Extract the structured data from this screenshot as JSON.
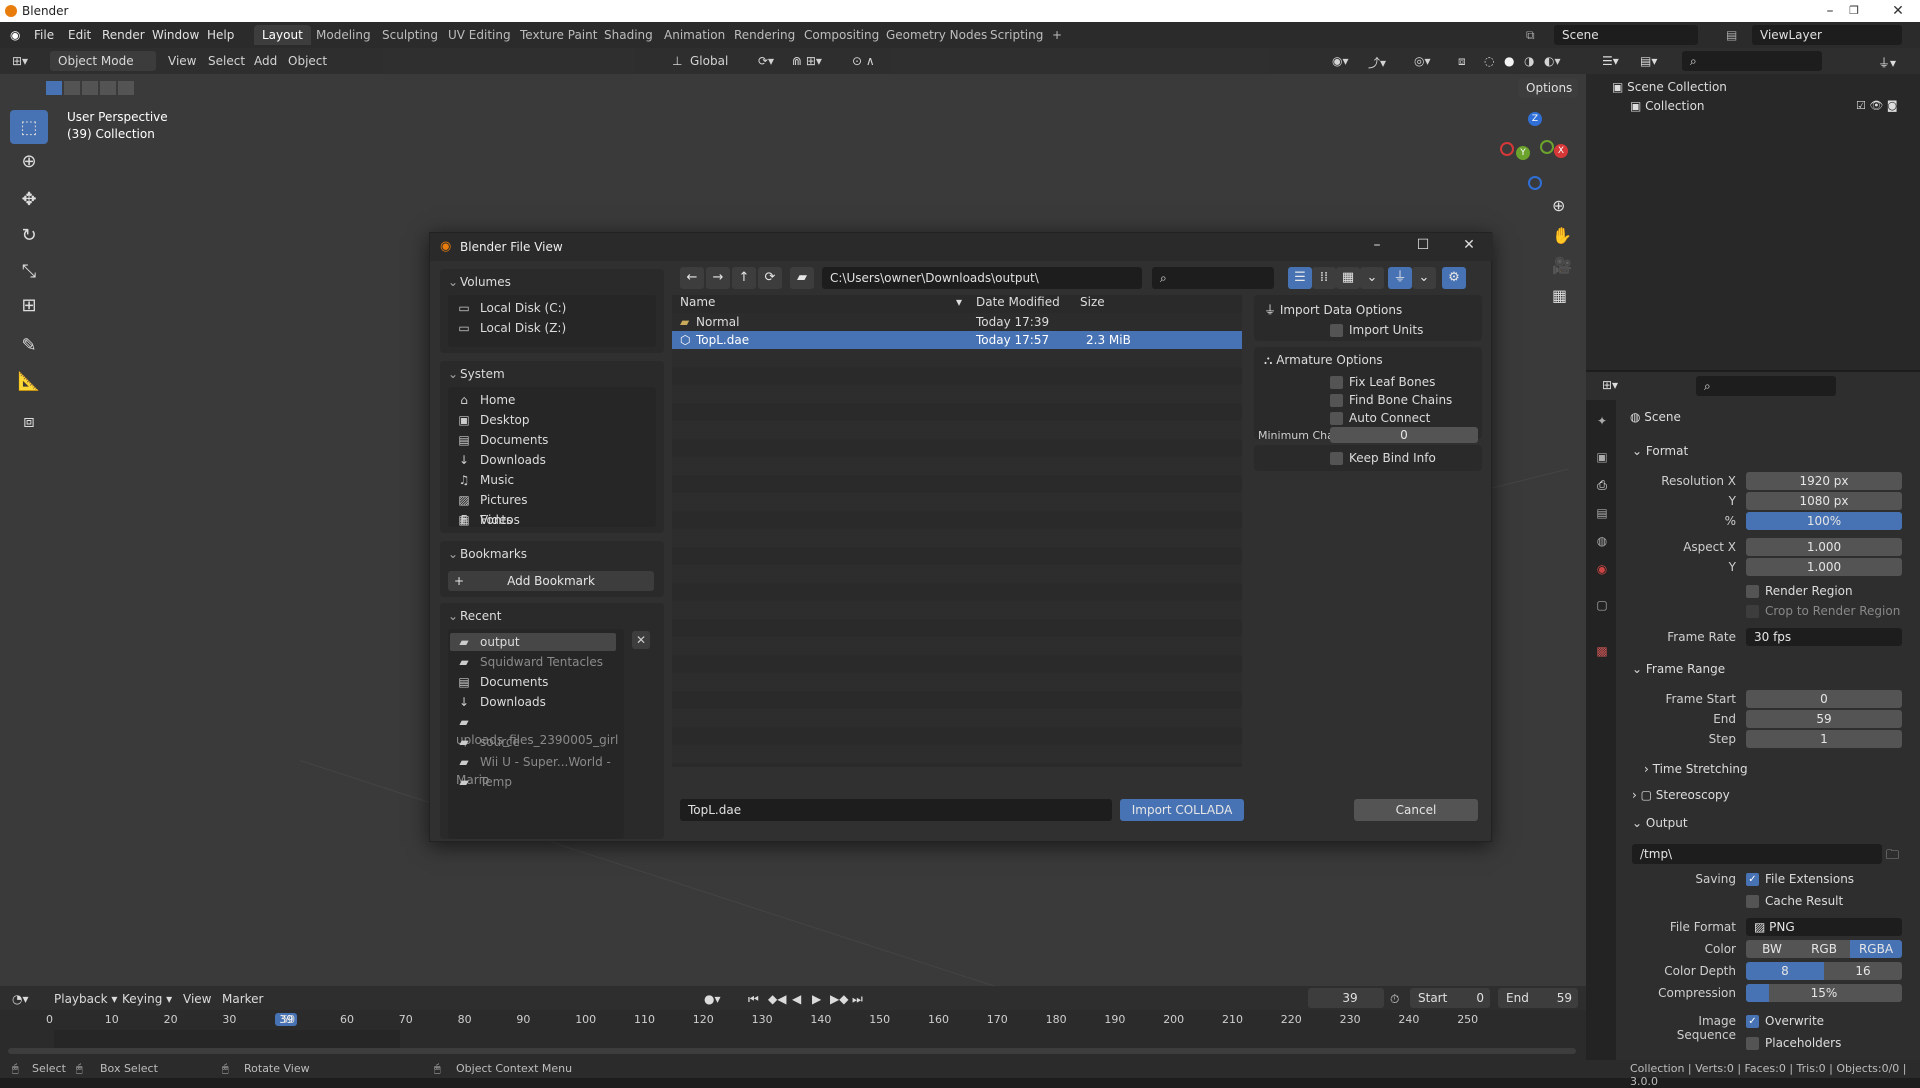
{
  "app": {
    "title": "Blender"
  },
  "menu": [
    "File",
    "Edit",
    "Render",
    "Window",
    "Help"
  ],
  "workspaces": [
    "Layout",
    "Modeling",
    "Sculpting",
    "UV Editing",
    "Texture Paint",
    "Shading",
    "Animation",
    "Rendering",
    "Compositing",
    "Geometry Nodes",
    "Scripting"
  ],
  "active_workspace": "Layout",
  "scene_name": "Scene",
  "view_layer": "ViewLayer",
  "viewport": {
    "mode": "Object Mode",
    "menus": [
      "View",
      "Select",
      "Add",
      "Object"
    ],
    "orientation": "Global",
    "options_label": "Options",
    "info_line1": "User Perspective",
    "info_line2": "(39) Collection"
  },
  "dialog": {
    "title": "Blender File View",
    "path": "C:\\Users\\owner\\Downloads\\output\\",
    "search_placeholder": "",
    "volumes_label": "Volumes",
    "volumes": [
      "Local Disk (C:)",
      "Local Disk (Z:)"
    ],
    "system_label": "System",
    "system": [
      "Home",
      "Desktop",
      "Documents",
      "Downloads",
      "Music",
      "Pictures",
      "Videos",
      "Fonts"
    ],
    "bookmarks_label": "Bookmarks",
    "add_bookmark": "Add Bookmark",
    "recent_label": "Recent",
    "recent": [
      "output",
      "Squidward Tentacles",
      "Documents",
      "Downloads",
      "uploads_files_2390005_girl",
      "source",
      "Wii U - Super...World - Mario",
      "Temp"
    ],
    "columns": {
      "name": "Name",
      "date": "Date Modified",
      "size": "Size"
    },
    "files": [
      {
        "name": "Normal",
        "date": "Today 17:39",
        "size": ""
      },
      {
        "name": "TopL.dae",
        "date": "Today 17:57",
        "size": "2.3 MiB"
      }
    ],
    "filename": "TopL.dae",
    "import_button": "Import COLLADA",
    "cancel_button": "Cancel",
    "import_data_options": "Import Data Options",
    "import_units": "Import Units",
    "armature_options": "Armature Options",
    "fix_leaf_bones": "Fix Leaf Bones",
    "find_bone_chains": "Find Bone Chains",
    "auto_connect": "Auto Connect",
    "min_chain_label": "Minimum Chai...",
    "min_chain_value": "0",
    "keep_bind_info": "Keep Bind Info"
  },
  "outliner": {
    "scene_collection": "Scene Collection",
    "collection": "Collection"
  },
  "properties": {
    "scene_label": "Scene",
    "format_label": "Format",
    "resolution_x_label": "Resolution X",
    "resolution_x": "1920 px",
    "y_label": "Y",
    "resolution_y": "1080 px",
    "percent_label": "%",
    "percent": "100%",
    "aspect_x_label": "Aspect X",
    "aspect_x": "1.000",
    "aspect_y": "1.000",
    "render_region": "Render Region",
    "crop_region": "Crop to Render Region",
    "frame_rate_label": "Frame Rate",
    "frame_rate": "30 fps",
    "frame_range_label": "Frame Range",
    "frame_start_label": "Frame Start",
    "frame_start": "0",
    "end_label": "End",
    "end": "59",
    "step_label": "Step",
    "step": "1",
    "time_stretching": "Time Stretching",
    "stereoscopy": "Stereoscopy",
    "output_label": "Output",
    "output_path": "/tmp\\",
    "saving_label": "Saving",
    "file_extensions": "File Extensions",
    "cache_result": "Cache Result",
    "file_format_label": "File Format",
    "file_format": "PNG",
    "color_label": "Color",
    "color_options": [
      "BW",
      "RGB",
      "RGBA"
    ],
    "color_depth_label": "Color Depth",
    "color_depth_options": [
      "8",
      "16"
    ],
    "compression_label": "Compression",
    "compression": "15%",
    "compression_value": 0.15,
    "image_sequence_label": "Image Sequence",
    "overwrite": "Overwrite",
    "placeholders": "Placeholders"
  },
  "timeline": {
    "menus": [
      "Playback",
      "Keying",
      "View",
      "Marker"
    ],
    "current_frame": "39",
    "start_label": "Start",
    "start": "0",
    "end_label": "End",
    "end": "59",
    "ticks": [
      "0",
      "10",
      "20",
      "30",
      "39",
      "50",
      "60",
      "70",
      "80",
      "90",
      "100",
      "110",
      "120",
      "130",
      "140",
      "150",
      "160",
      "170",
      "180",
      "190",
      "200",
      "210",
      "220",
      "230",
      "240",
      "250"
    ]
  },
  "status": {
    "select": "Select",
    "box_select": "Box Select",
    "rotate_view": "Rotate View",
    "context_menu": "Object Context Menu",
    "stats": "Collection | Verts:0 | Faces:0 | Tris:0 | Objects:0/0 | 3.0.0"
  },
  "colors": {
    "accent": "#4772b3",
    "brand": "#e87d0d",
    "bg": "#303030"
  }
}
